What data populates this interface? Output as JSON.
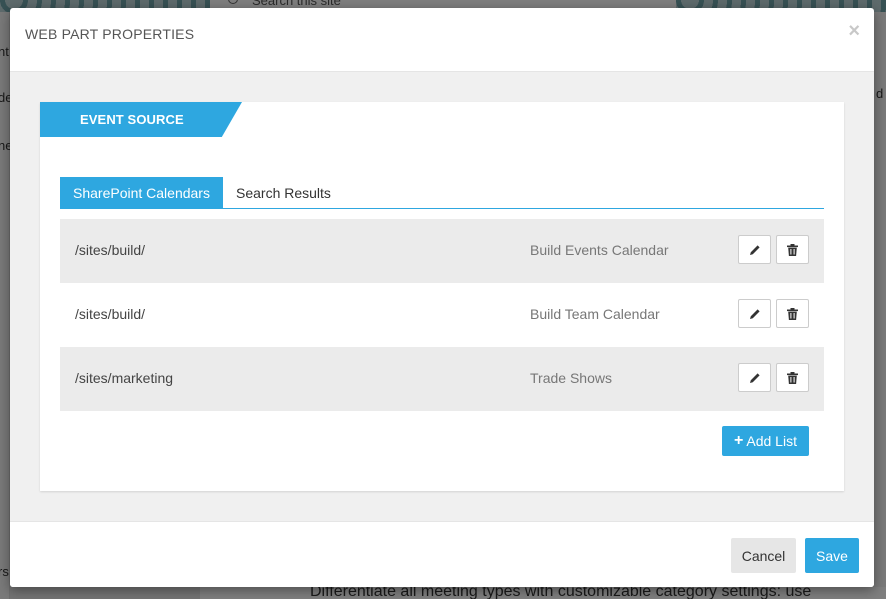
{
  "background": {
    "search_placeholder": "Search this site",
    "left_fragments": [
      "nt",
      "de",
      "ne",
      "rs"
    ],
    "right_fragment": "d",
    "bottom_text": "Differentiate all meeting types with customizable category settings: use"
  },
  "modal": {
    "title": "WEB PART PROPERTIES",
    "close_glyph": "×",
    "panel_heading": "EVENT SOURCE",
    "tabs": [
      {
        "label": "SharePoint Calendars",
        "active": true
      },
      {
        "label": "Search Results",
        "active": false
      }
    ],
    "rows": [
      {
        "path": "/sites/build/",
        "title": "Build Events Calendar"
      },
      {
        "path": "/sites/build/",
        "title": "Build Team Calendar"
      },
      {
        "path": "/sites/marketing",
        "title": "Trade Shows"
      }
    ],
    "row_icons": {
      "edit": "pencil-icon",
      "delete": "trash-icon"
    },
    "add_list_label": "Add List",
    "add_list_icon": "plus-icon",
    "cancel_label": "Cancel",
    "save_label": "Save"
  },
  "colors": {
    "accent": "#2ea7e0",
    "row_shade": "#ebebeb",
    "body_bg": "#f0f0f0"
  }
}
